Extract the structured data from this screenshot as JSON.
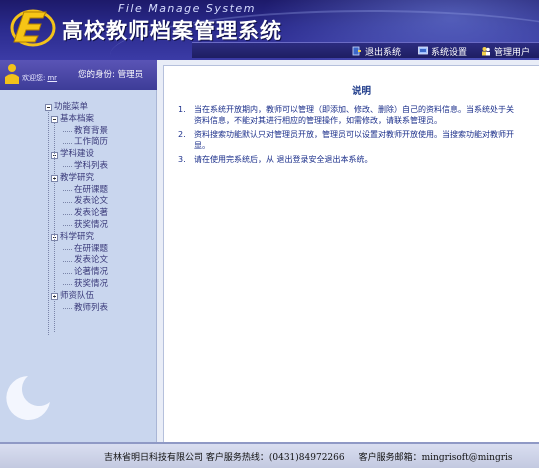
{
  "header": {
    "subtitle": "File Manage System",
    "title": "高校教师档案管理系统"
  },
  "menu": {
    "logout": "退出系统",
    "settings": "系统设置",
    "admin_users": "管理用户"
  },
  "user_panel": {
    "welcome_label": "欢迎您:",
    "username": "mr",
    "identity_label": "您的身份:",
    "identity_value": "管理员"
  },
  "tree": {
    "root": "功能菜单",
    "groups": [
      {
        "label": "基本档案",
        "children": [
          "教育背景",
          "工作简历"
        ]
      },
      {
        "label": "学科建设",
        "children": [
          "学科列表"
        ]
      },
      {
        "label": "教学研究",
        "children": [
          "在研课题",
          "发表论文",
          "发表论著",
          "获奖情况"
        ]
      },
      {
        "label": "科学研究",
        "children": [
          "在研课题",
          "发表论文",
          "论著情况",
          "获奖情况"
        ]
      },
      {
        "label": "师资队伍",
        "children": [
          "教师列表"
        ]
      }
    ]
  },
  "main": {
    "title": "说明",
    "notes": [
      {
        "num": "1.",
        "lines": [
          "当在系统开放期内，教师可以管理（即添加、修改、删除）自己的资料信息。当系统处于关",
          "资料信息，不能对其进行相应的管理操作，如需修改，请联系管理员。"
        ]
      },
      {
        "num": "2.",
        "lines": [
          "资料搜索功能默认只对管理员开放，管理员可以设置对教师开放使用。当搜索功能对教师开",
          "显。"
        ]
      },
      {
        "num": "3.",
        "lines": [
          "请在使用完系统后，从 退出登录安全退出本系统。"
        ]
      }
    ]
  },
  "footer": {
    "company": "吉林省明日科技有限公司 客户服务热线：(0431)84972266",
    "email": "客户服务邮箱：mingrisoft@mingris"
  },
  "colors": {
    "header_bg": "#2a2a8c",
    "tree_bg": "#c9d6ee",
    "title_color": "#1e3b8a"
  }
}
